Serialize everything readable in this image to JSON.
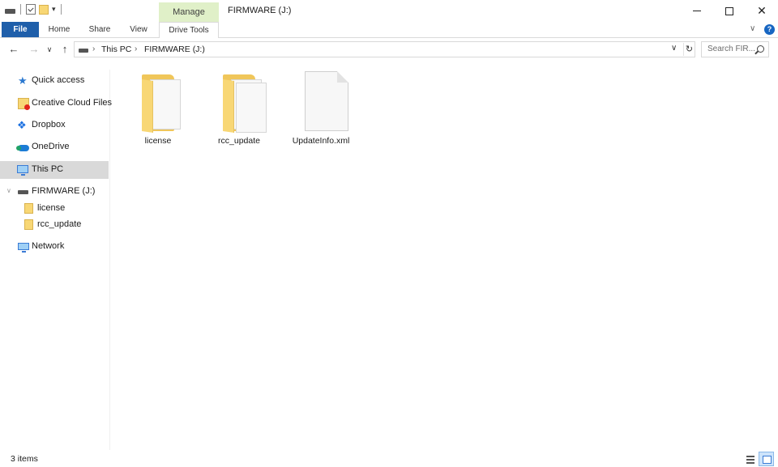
{
  "window": {
    "title": "FIRMWARE (J:)",
    "context_tab_group": "Manage",
    "qat_customize": "▾"
  },
  "ribbon": {
    "tabs": [
      {
        "label": "File"
      },
      {
        "label": "Home"
      },
      {
        "label": "Share"
      },
      {
        "label": "View"
      },
      {
        "label": "Drive Tools"
      }
    ],
    "help": "?"
  },
  "address": {
    "crumbs": [
      "This PC",
      "FIRMWARE (J:)"
    ],
    "search_placeholder": "Search FIR..."
  },
  "nav_pane": {
    "items": [
      {
        "label": "Quick access",
        "icon": "star-icon"
      },
      {
        "label": "Creative Cloud Files",
        "icon": "creative-cloud-folder-icon"
      },
      {
        "label": "Dropbox",
        "icon": "dropbox-icon"
      },
      {
        "label": "OneDrive",
        "icon": "onedrive-cloud-icon"
      },
      {
        "label": "This PC",
        "icon": "computer-icon",
        "selected": true
      },
      {
        "label": "FIRMWARE (J:)",
        "icon": "drive-icon"
      },
      {
        "label": "license",
        "icon": "folder-icon"
      },
      {
        "label": "rcc_update",
        "icon": "folder-icon"
      },
      {
        "label": "Network",
        "icon": "network-icon"
      }
    ]
  },
  "content": {
    "items": [
      {
        "name": "license",
        "type": "folder"
      },
      {
        "name": "rcc_update",
        "type": "folder"
      },
      {
        "name": "UpdateInfo.xml",
        "type": "file"
      }
    ]
  },
  "status": {
    "item_count": "3 items"
  },
  "colors": {
    "file_tab": "#1f5faa",
    "context_tab": "#e0f0c8",
    "selection": "#d9d9d9",
    "folder": "#f8d775"
  }
}
